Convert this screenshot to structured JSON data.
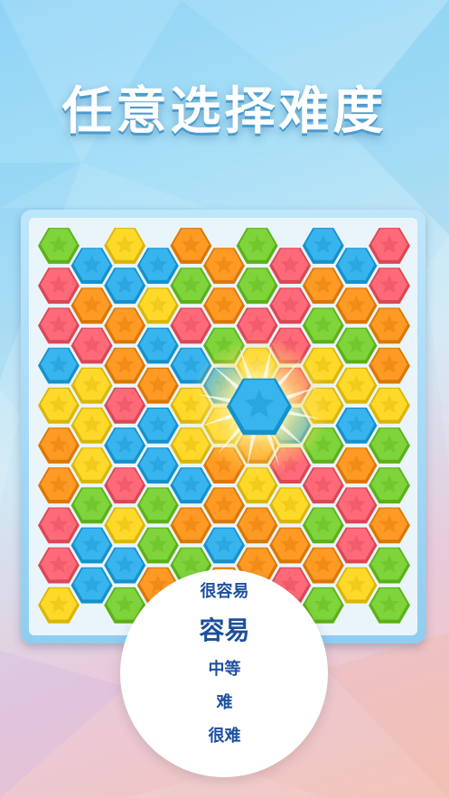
{
  "title": "任意选择难度",
  "difficulty_options": [
    "很容易",
    "容易",
    "中等",
    "难",
    "很难"
  ],
  "selected_option": "容易",
  "colors": {
    "green": "#7fd43b",
    "blue": "#38b4ef",
    "orange": "#ff9a25",
    "red": "#ff6a78",
    "yellow": "#ffd92a",
    "text": "#1c4f9e"
  },
  "icons": {
    "tile": "star-icon",
    "highlight": "glow-burst-icon"
  },
  "board": {
    "rows": [
      "G.Y.O.G.B.R",
      ".B.B.O.R.B.",
      "R.B.G.G.O.R",
      ".O.Y.O.R.O.",
      "R.O.R.R.G.O",
      ".R.B.G.R.G.",
      "B.O.B.Y.Y.O",
      ".Y.O.B.R.Y.",
      "Y.R.Y.G.Y.Y",
      ".Y.B.Y.B.B.",
      "O.B.Y.O.G.G",
      ".Y.B.O.R.O.",
      "O.R.B.Y.R.G",
      ".G.G.O.Y.R.",
      "R.Y.O.O.G.O",
      ".B.G.B.O.R.",
      "R.B.G.O.O.G",
      ".B.O.O.R.Y.",
      "Y.G.G.B.G.G"
    ],
    "selected_tile": "B"
  }
}
